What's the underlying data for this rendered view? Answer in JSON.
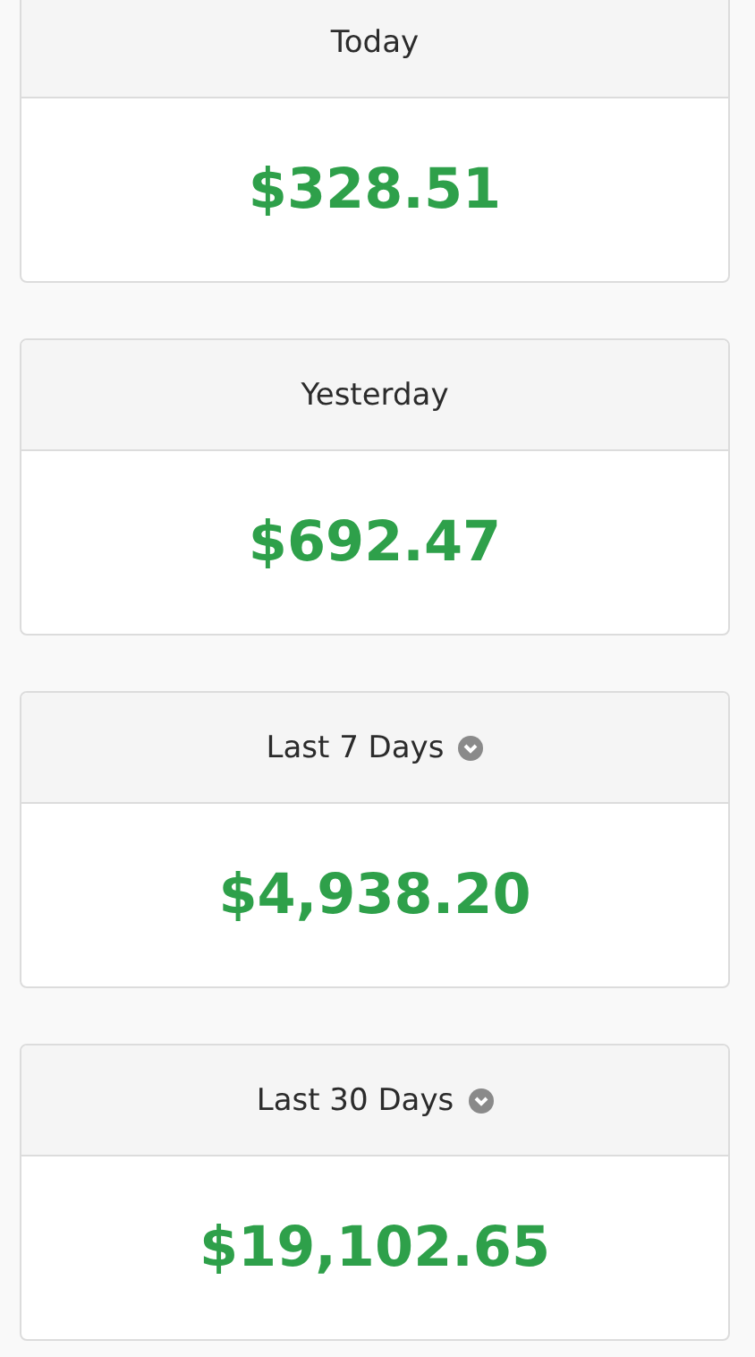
{
  "cards": [
    {
      "title": "Today",
      "amount": "$328.51",
      "dropdown": false
    },
    {
      "title": "Yesterday",
      "amount": "$692.47",
      "dropdown": false
    },
    {
      "title": "Last 7 Days",
      "amount": "$4,938.20",
      "dropdown": true
    },
    {
      "title": "Last 30 Days",
      "amount": "$19,102.65",
      "dropdown": true
    }
  ]
}
